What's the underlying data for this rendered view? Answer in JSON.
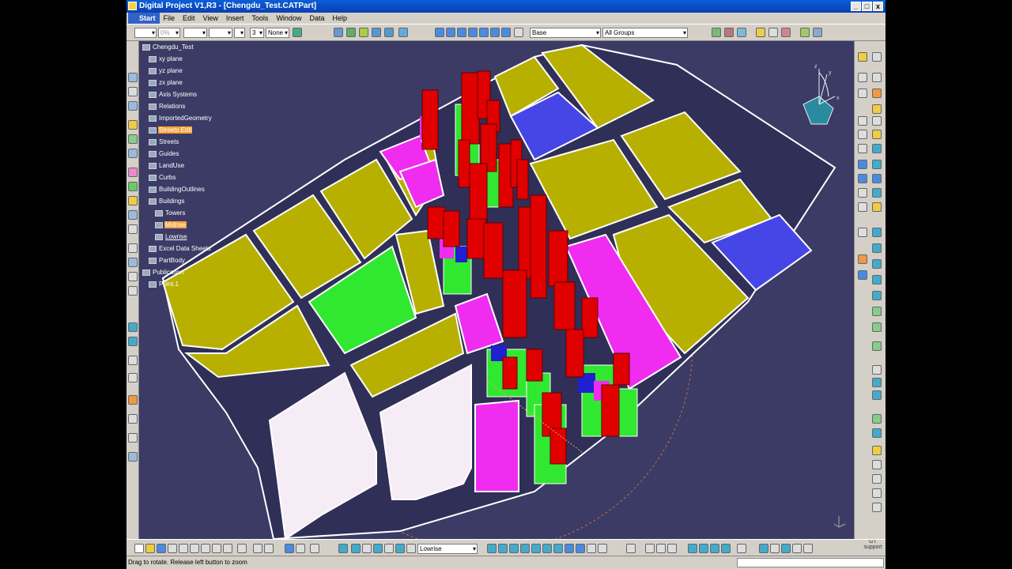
{
  "window": {
    "title": "Digital Project V1,R3 - [Chengdu_Test.CATPart]"
  },
  "menu": [
    "Start",
    "File",
    "Edit",
    "View",
    "Insert",
    "Tools",
    "Window",
    "Data",
    "Help"
  ],
  "toolbar_top": {
    "linetype": "",
    "zoom": "0%",
    "linestyle": "",
    "lineweight": "",
    "layer_num": "3",
    "layer_label": "None",
    "base": "Base",
    "groups": "All Groups"
  },
  "toolbar_bottom": {
    "layer": "Lowrise"
  },
  "tree": [
    {
      "label": "Chengdu_Test",
      "level": 0,
      "selected": false
    },
    {
      "label": "xy plane",
      "level": 1,
      "selected": false
    },
    {
      "label": "yz plane",
      "level": 1,
      "selected": false
    },
    {
      "label": "zx plane",
      "level": 1,
      "selected": false
    },
    {
      "label": "Axis Systems",
      "level": 1,
      "selected": false
    },
    {
      "label": "Relations",
      "level": 1,
      "selected": false
    },
    {
      "label": "ImportedGeometry",
      "level": 1,
      "selected": false
    },
    {
      "label": "Streets Edit",
      "level": 1,
      "selected": true
    },
    {
      "label": "Streets",
      "level": 1,
      "selected": false
    },
    {
      "label": "Guides",
      "level": 1,
      "selected": false
    },
    {
      "label": "LandUse",
      "level": 1,
      "selected": false
    },
    {
      "label": "Curbs",
      "level": 1,
      "selected": false
    },
    {
      "label": "BuildingOutlines",
      "level": 1,
      "selected": false
    },
    {
      "label": "Buildings",
      "level": 1,
      "selected": false
    },
    {
      "label": "Towers",
      "level": 2,
      "selected": false
    },
    {
      "label": "Midrise",
      "level": 2,
      "selected": true
    },
    {
      "label": "Lowrise",
      "level": 2,
      "selected": false
    },
    {
      "label": "Excel Data Sheets",
      "level": 1,
      "selected": false
    },
    {
      "label": "PartBody",
      "level": 1,
      "selected": false
    },
    {
      "label": "Publication",
      "level": 0,
      "selected": false
    },
    {
      "label": "Point.1",
      "level": 1,
      "selected": false
    }
  ],
  "status": {
    "text": "Drag to rotate. Release left button to zoom"
  },
  "colors": {
    "viewport": "#3b3b66",
    "yellow": "#b8b000",
    "magenta": "#f02cf0",
    "blue": "#4646e6",
    "green": "#30e830",
    "white": "#f6ecf6",
    "red": "#e00000"
  },
  "compass": {
    "x": "x",
    "y": "y",
    "z": "z"
  },
  "brand": "GT support"
}
